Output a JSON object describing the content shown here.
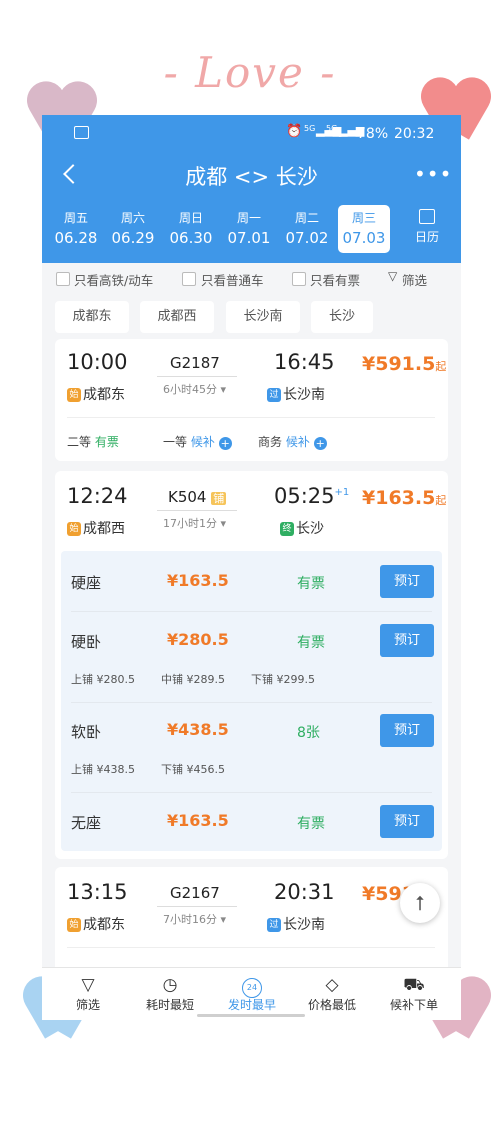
{
  "decoration": {
    "love_text": "- Love -"
  },
  "status": {
    "battery": "78%",
    "time": "20:32",
    "signal1": "5G",
    "signal2": "5G"
  },
  "header": {
    "title": "成都 <> 长沙",
    "back_icon": "chevron-left-icon",
    "more_icon": "more-icon"
  },
  "dates": [
    {
      "weekday": "周五",
      "date": "06.28"
    },
    {
      "weekday": "周六",
      "date": "06.29"
    },
    {
      "weekday": "周日",
      "date": "06.30"
    },
    {
      "weekday": "周一",
      "date": "07.01"
    },
    {
      "weekday": "周二",
      "date": "07.02"
    },
    {
      "weekday": "周三",
      "date": "07.03"
    }
  ],
  "calendar_label": "日历",
  "filters": {
    "high_speed": "只看高铁/动车",
    "normal": "只看普通车",
    "has_ticket": "只看有票",
    "filter": "筛选"
  },
  "stations": [
    "成都东",
    "成都西",
    "长沙南",
    "长沙"
  ],
  "trains": [
    {
      "depart": "10:00",
      "no": "G2187",
      "arrive": "16:45",
      "duration": "6小时45分",
      "from_badge": "始",
      "from": "成都东",
      "to_badge": "过",
      "to": "长沙南",
      "price": "¥591.5",
      "price_suffix": "起",
      "seat1_name": "二等",
      "seat1_status": "有票",
      "seat2_name": "一等",
      "seat2_status": "候补",
      "seat3_name": "商务",
      "seat3_status": "候补"
    },
    {
      "depart": "12:24",
      "no": "K504",
      "tag": "铺",
      "arrive": "05:25",
      "arrive_sup": "+1",
      "duration": "17小时1分",
      "from_badge": "始",
      "from": "成都西",
      "to_badge": "终",
      "to": "长沙",
      "price": "¥163.5",
      "price_suffix": "起",
      "seats": [
        {
          "name": "硬座",
          "price": "¥163.5",
          "avail": "有票",
          "btn": "预订"
        },
        {
          "name": "硬卧",
          "price": "¥280.5",
          "avail": "有票",
          "btn": "预订",
          "upper": "上铺 ¥280.5",
          "middle": "中铺 ¥289.5",
          "lower": "下铺 ¥299.5"
        },
        {
          "name": "软卧",
          "price": "¥438.5",
          "avail": "8张",
          "btn": "预订",
          "upper": "上铺 ¥438.5",
          "lower": "下铺 ¥456.5"
        },
        {
          "name": "无座",
          "price": "¥163.5",
          "avail": "有票",
          "btn": "预订"
        }
      ]
    },
    {
      "depart": "13:15",
      "no": "G2167",
      "arrive": "20:31",
      "duration": "7小时16分",
      "from_badge": "始",
      "from": "成都东",
      "to_badge": "过",
      "to": "长沙南",
      "price": "¥591"
    }
  ],
  "bottom_nav": [
    {
      "label": "筛选",
      "icon": "funnel-icon"
    },
    {
      "label": "耗时最短",
      "icon": "timer-icon"
    },
    {
      "label": "发时最早",
      "icon": "clock-24-icon",
      "icon_text": "24"
    },
    {
      "label": "价格最低",
      "icon": "price-tag-icon"
    },
    {
      "label": "候补下单",
      "icon": "cart-icon"
    }
  ],
  "colors": {
    "accent": "#3f97e8",
    "price": "#f07a28",
    "available": "#2fae62"
  }
}
